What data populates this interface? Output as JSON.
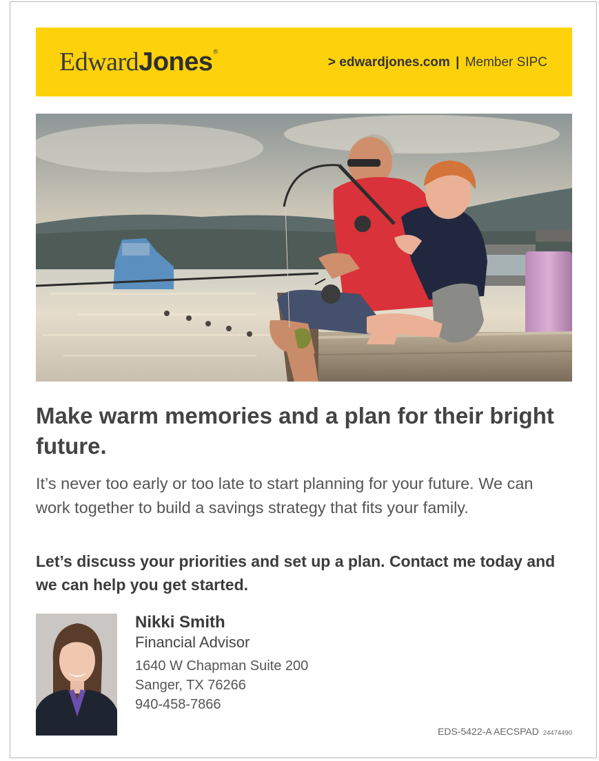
{
  "brand": {
    "logo_first": "Edward",
    "logo_last": "Jones",
    "logo_mark": "®",
    "url_text": "> edwardjones.com",
    "separator": "|",
    "member_text": "Member SIPC",
    "accent_color": "#fdd20a"
  },
  "hero_image": {
    "icon": "photo-grandfather-grandson-fishing"
  },
  "headline": "Make warm memories and a plan for their bright future.",
  "body": "It’s never too early or too late to start planning for your future. We can work together to build a savings strategy that fits your family.",
  "cta": "Let’s discuss your priorities and set up a plan. Contact me today and we can help you get started.",
  "advisor": {
    "name": "Nikki Smith",
    "title": "Financial Advisor",
    "address_line1": "1640 W Chapman Suite 200",
    "address_line2": "Sanger, TX 76266",
    "phone": "940-458-7866",
    "photo_icon": "advisor-portrait"
  },
  "footer": {
    "code": "EDS-5422-A AECSPAD",
    "number": "24474490"
  }
}
